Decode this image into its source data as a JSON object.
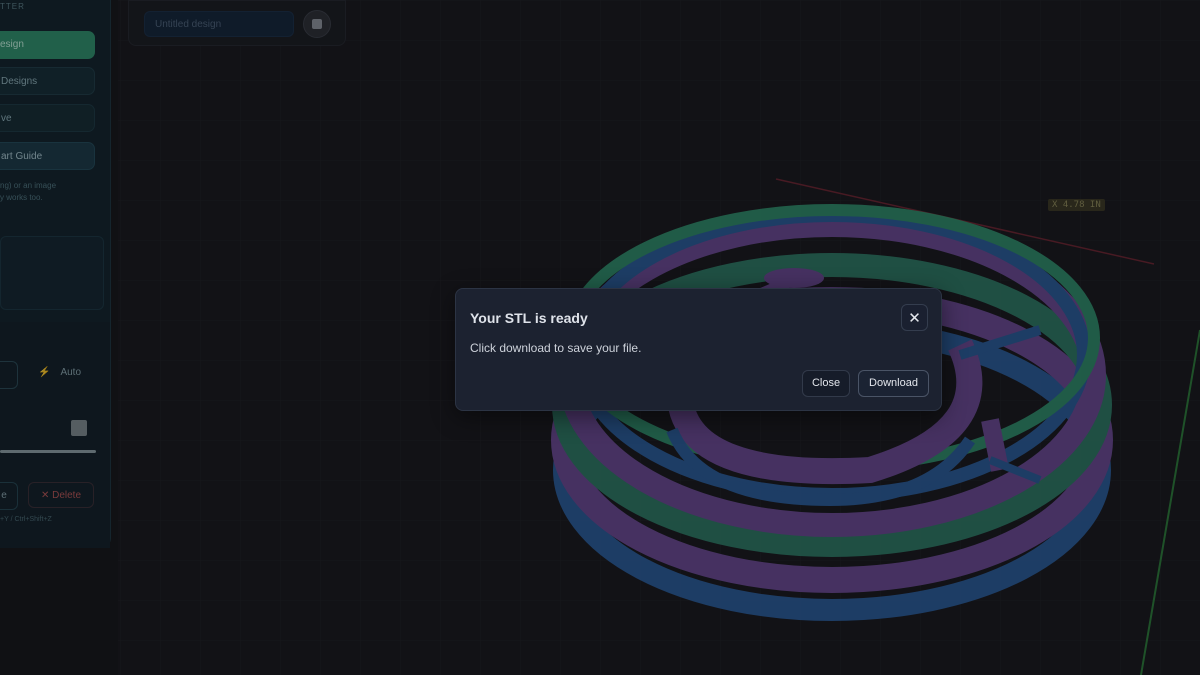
{
  "sidebar": {
    "header": "TTER",
    "new_design_label": "esign",
    "my_designs_label": "Designs",
    "save_label": "ve",
    "guide_label": "art Guide",
    "hint_line1": "ng) or an image",
    "hint_line2": "y works too.",
    "auto_label": "Auto",
    "duplicate_label": "e",
    "delete_label": "✕ Delete",
    "shortcut_hint": "+Y / Ctrl+Shift+Z"
  },
  "topbar": {
    "design_name_placeholder": "Untitled design"
  },
  "viewport": {
    "axis_label": "X 4.78 IN"
  },
  "modal": {
    "title": "Your STL is ready",
    "message": "Click download to save your file.",
    "close_x": "✕",
    "close_label": "Close",
    "download_label": "Download"
  },
  "colors": {
    "background": "#15161a",
    "modal_bg": "#1c2230",
    "ring_green": "#2f8f6c",
    "ring_purple": "#6d4a96",
    "ring_blue": "#2b5d9c"
  }
}
